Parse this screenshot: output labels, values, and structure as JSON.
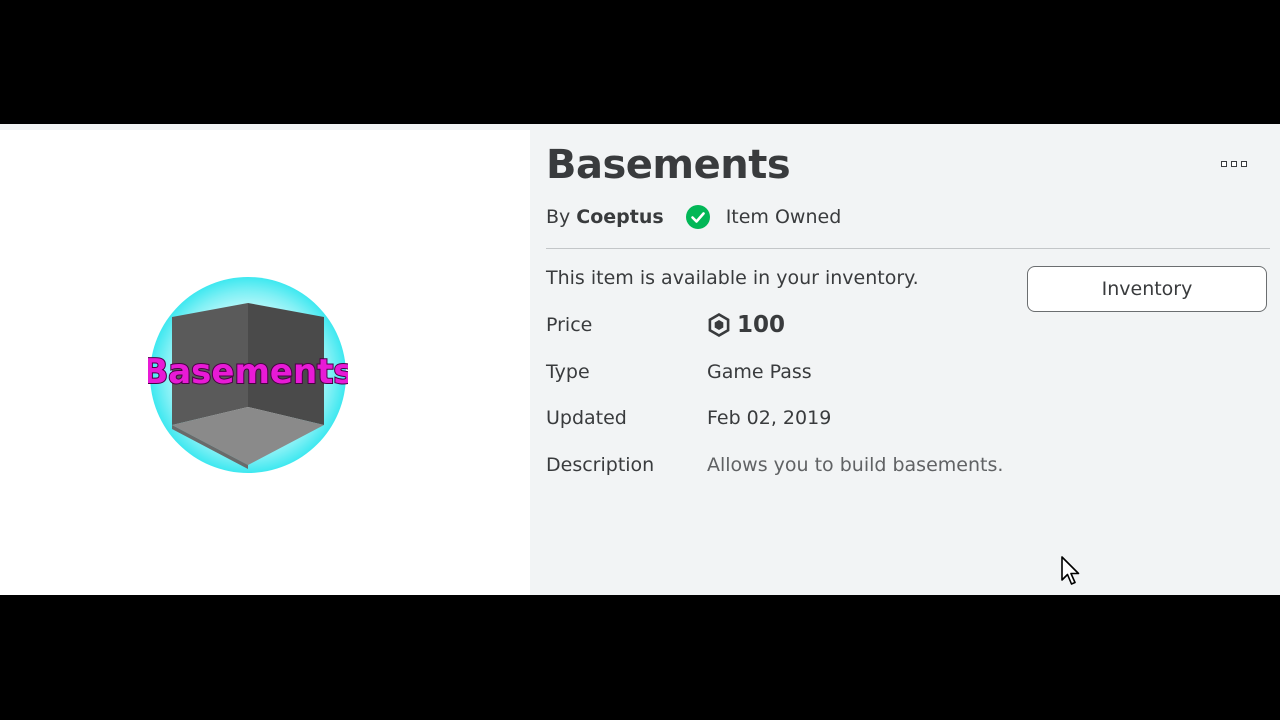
{
  "item": {
    "title": "Basements",
    "thumbnail_text": "Basements",
    "by_label": "By",
    "creator": "Coeptus",
    "owned_text": "Item Owned",
    "available_text": "This item is available in your inventory.",
    "inventory_button": "Inventory"
  },
  "details": [
    {
      "label": "Price",
      "value": "100",
      "icon": "robux-icon"
    },
    {
      "label": "Type",
      "value": "Game Pass"
    },
    {
      "label": "Updated",
      "value": "Feb 02, 2019"
    },
    {
      "label": "Description",
      "value": "Allows you to build basements."
    }
  ],
  "icons": {
    "more": "more-options-icon",
    "owned": "check-circle-icon",
    "currency": "robux-icon",
    "pointer": "mouse-cursor-icon"
  },
  "colors": {
    "owned_green": "#02b757",
    "thumbnail_ring": "#3ee8f0",
    "thumbnail_text": "#e81ad6",
    "page_background": "#f2f4f5",
    "text": "#393b3d"
  }
}
